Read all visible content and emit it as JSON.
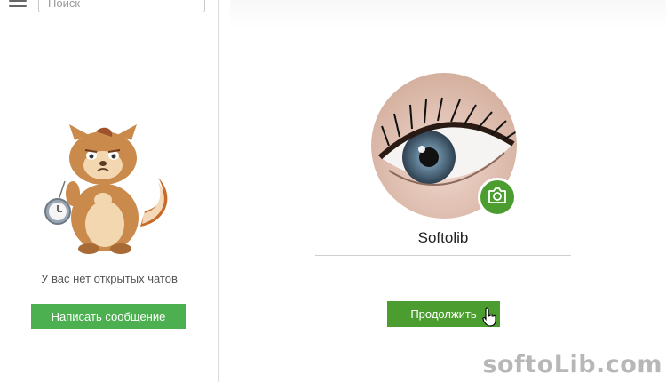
{
  "sidebar": {
    "search_placeholder": "Поиск",
    "empty_text": "У вас нет открытых чатов",
    "write_button_label": "Написать сообщение"
  },
  "profile": {
    "name": "Softolib",
    "continue_label": "Продолжить"
  },
  "colors": {
    "accent_green": "#4caf50",
    "dark_green": "#4a9d2e"
  },
  "watermark": "softoLib.com"
}
